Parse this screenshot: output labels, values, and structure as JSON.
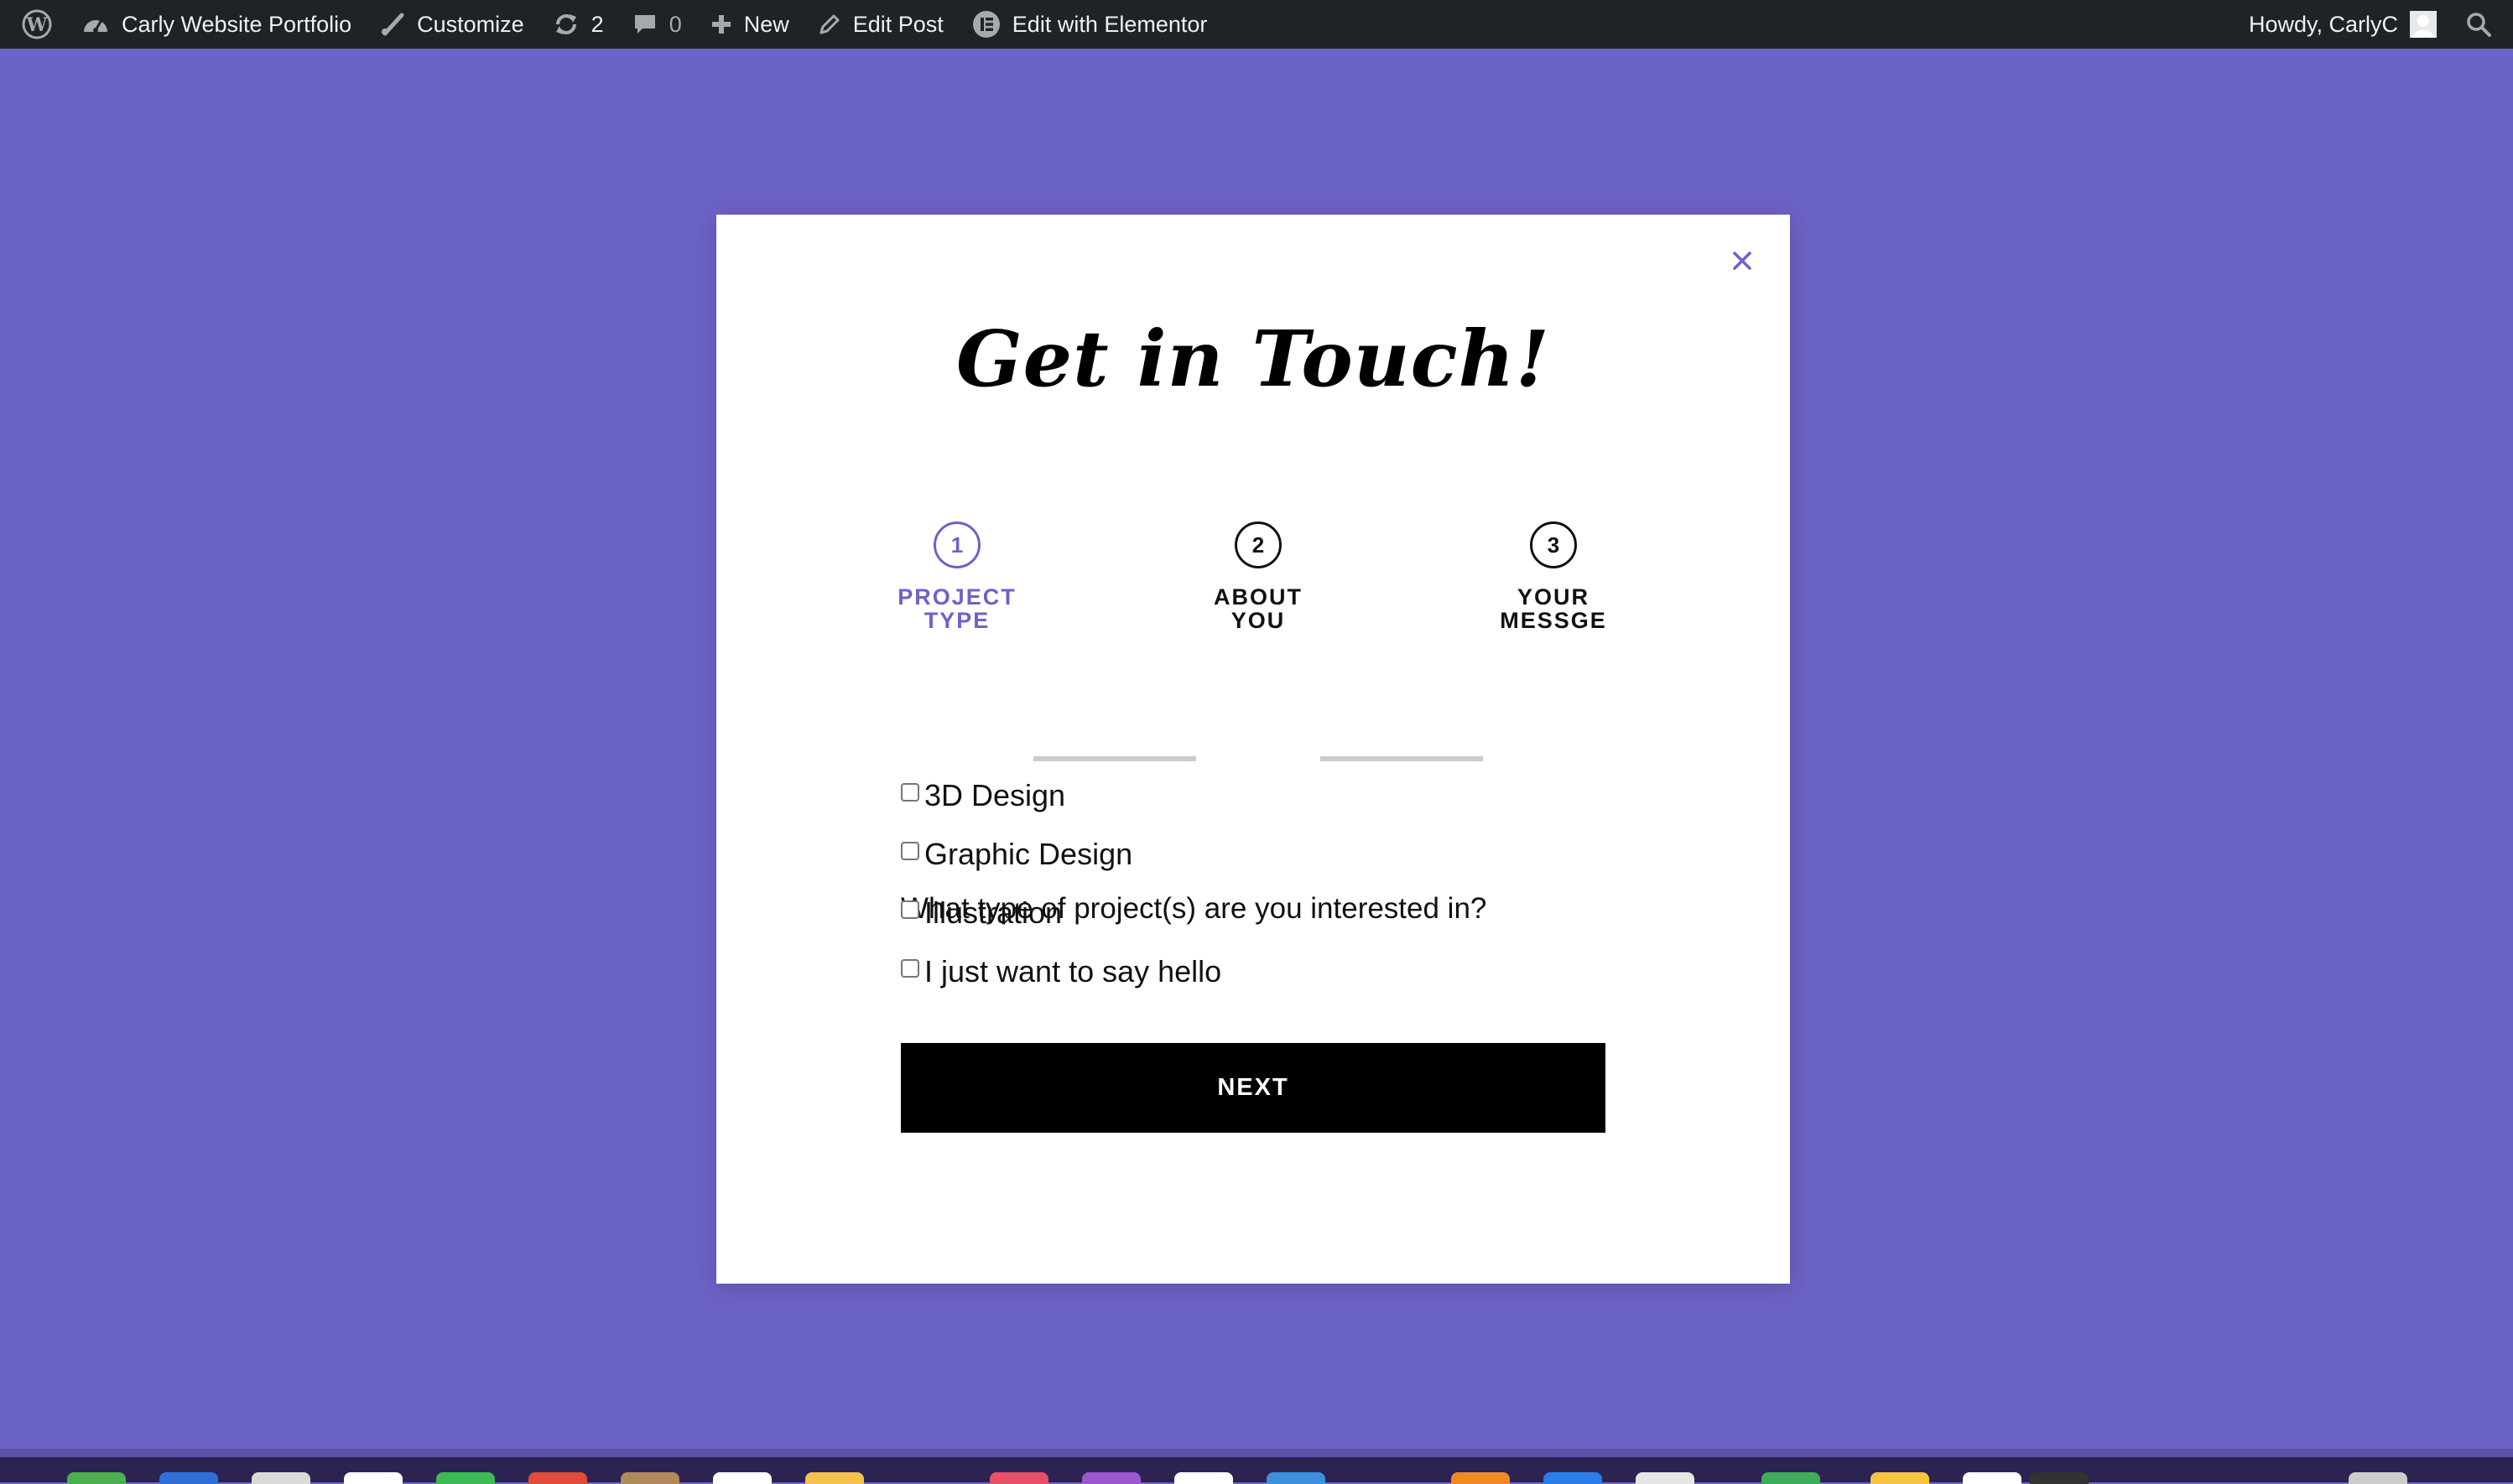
{
  "adminbar": {
    "site_name": "Carly Website Portfolio",
    "customize": "Customize",
    "updates_count": "2",
    "comments_count": "0",
    "new_label": "New",
    "edit_post": "Edit Post",
    "edit_elementor": "Edit with Elementor",
    "howdy": "Howdy, CarlyC"
  },
  "modal": {
    "title": "Get in Touch!",
    "close_symbol": "×",
    "steps": [
      {
        "number": "1",
        "label_line1": "PROJECT",
        "label_line2": "TYPE",
        "active": true
      },
      {
        "number": "2",
        "label_line1": "ABOUT",
        "label_line2": "YOU",
        "active": false
      },
      {
        "number": "3",
        "label_line1": "YOUR",
        "label_line2": "MESSGE",
        "active": false
      }
    ],
    "question": "What type of project(s) are you interested in?",
    "options": [
      {
        "label": "3D Design",
        "checked": false
      },
      {
        "label": "Graphic Design",
        "checked": false
      },
      {
        "label": "Illustration",
        "checked": false
      },
      {
        "label": "I just want to say hello",
        "checked": false
      }
    ],
    "next_button": "NEXT"
  },
  "colors": {
    "background": "#6c63c6",
    "accent": "#6c63c6",
    "adminbar": "#1d2327",
    "button": "#000000"
  }
}
